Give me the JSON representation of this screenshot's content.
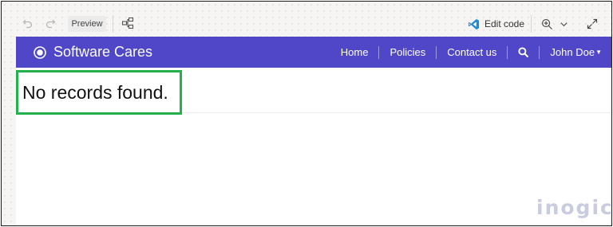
{
  "toolbar": {
    "undo_icon": "undo-icon",
    "redo_icon": "redo-icon",
    "preview_label": "Preview",
    "sitemap_icon": "sitemap-icon",
    "edit_code_label": "Edit code",
    "edit_code_icon": "vscode-icon",
    "zoom_icon": "zoom-in-icon",
    "chevron_icon": "chevron-down-icon",
    "expand_icon": "expand-icon"
  },
  "site": {
    "brand_name": "Software Cares",
    "brand_color": "#5047c8",
    "nav": [
      "Home",
      "Policies",
      "Contact us"
    ],
    "user_name": "John Doe",
    "search_icon": "search-icon"
  },
  "content": {
    "message": "No records found.",
    "highlight_color": "#22b14c"
  },
  "watermark": "inogic"
}
